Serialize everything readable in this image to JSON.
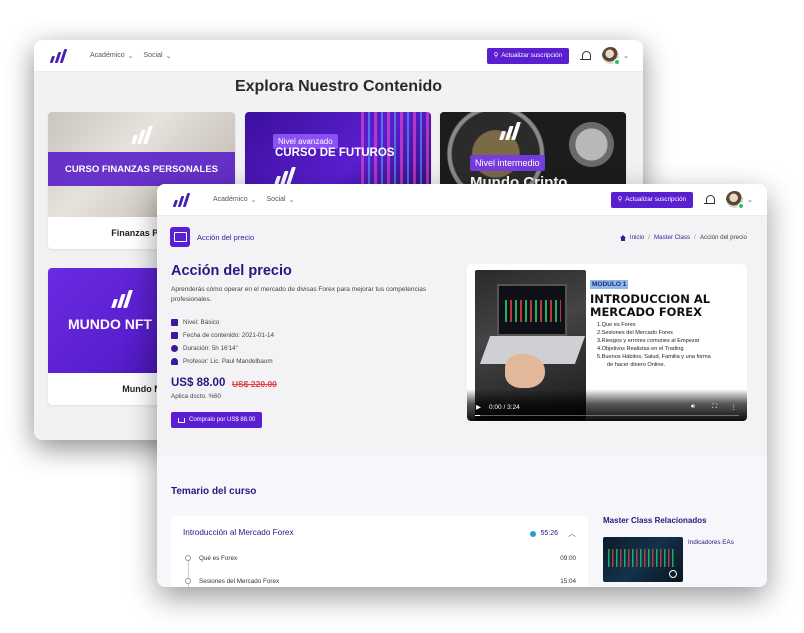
{
  "back_window": {
    "nav": {
      "menu1": "Académico",
      "menu2": "Social",
      "subscribe": "Actualizar suscripción"
    },
    "title": "Explora Nuestro Contenido",
    "cards": [
      {
        "band": "CURSO FINANZAS PERSONALES",
        "caption": "Finanzas Pers"
      },
      {
        "tag": "Nivel avanzado",
        "big": "CURSO DE FUTUROS"
      },
      {
        "tag": "Nivel intermedio",
        "big": "Mundo Cripto"
      },
      {
        "big": "MUNDO NFT",
        "caption": "Mundo N"
      }
    ]
  },
  "front_window": {
    "nav": {
      "menu1": "Académico",
      "menu2": "Social",
      "subscribe": "Actualizar suscripción"
    },
    "subheader_title": "Acción del precio",
    "breadcrumb": {
      "home": "Inicio",
      "section": "Master Class",
      "current": "Acción del precio"
    },
    "course": {
      "title": "Acción del precio",
      "description": "Aprenderás cómo operar en el mercado de divisas Forex para mejorar tus competencias profesionales.",
      "level": "Nivel: Básico",
      "date": "Fecha de contenido: 2021-01-14",
      "duration": "Duración: 5h 16'14\"",
      "teacher": "Profesor: Lic. Paul Mandelbaum",
      "price": "US$ 88.00",
      "old_price": "US$ 220.00",
      "discount": "Aplica dscto. %60",
      "buy_label": "Compralo por US$ 88.00"
    },
    "video": {
      "module_tag": "MODULO 1",
      "heading_line1": "INTRODUCCION AL",
      "heading_line2": "MERCADO FOREX",
      "items": [
        "1.Que es Forex",
        "2.Sesiones del Mercado Forex",
        "3.Riesgos y errores comunes al Empezar",
        "4.Objetivos Realistas en el Trading",
        "5.Buenos Hábitos, Salud, Familia y una forma",
        "de hacer dinero Online."
      ],
      "time": "0:00 / 3:24",
      "progress": 0.02
    },
    "syllabus": {
      "title": "Temario del curso",
      "section_title": "Introducción al Mercado Forex",
      "section_duration": "55:26",
      "lessons": [
        {
          "name": "Qué es Forex",
          "duration": "09:00"
        },
        {
          "name": "Sesiones del Mercado Forex",
          "duration": "15:04"
        }
      ]
    },
    "related": {
      "title": "Master Class Relacionados",
      "item": "Indicadores EAs"
    }
  }
}
